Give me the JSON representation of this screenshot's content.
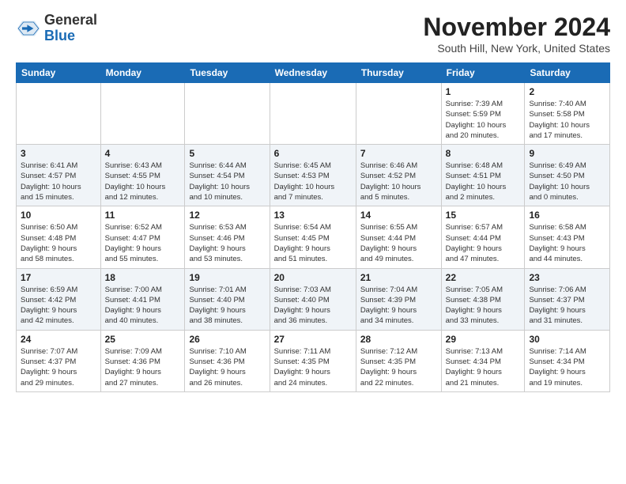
{
  "header": {
    "logo_general": "General",
    "logo_blue": "Blue",
    "month_title": "November 2024",
    "location": "South Hill, New York, United States"
  },
  "days_of_week": [
    "Sunday",
    "Monday",
    "Tuesday",
    "Wednesday",
    "Thursday",
    "Friday",
    "Saturday"
  ],
  "weeks": [
    [
      {
        "day": "",
        "info": ""
      },
      {
        "day": "",
        "info": ""
      },
      {
        "day": "",
        "info": ""
      },
      {
        "day": "",
        "info": ""
      },
      {
        "day": "",
        "info": ""
      },
      {
        "day": "1",
        "info": "Sunrise: 7:39 AM\nSunset: 5:59 PM\nDaylight: 10 hours\nand 20 minutes."
      },
      {
        "day": "2",
        "info": "Sunrise: 7:40 AM\nSunset: 5:58 PM\nDaylight: 10 hours\nand 17 minutes."
      }
    ],
    [
      {
        "day": "3",
        "info": "Sunrise: 6:41 AM\nSunset: 4:57 PM\nDaylight: 10 hours\nand 15 minutes."
      },
      {
        "day": "4",
        "info": "Sunrise: 6:43 AM\nSunset: 4:55 PM\nDaylight: 10 hours\nand 12 minutes."
      },
      {
        "day": "5",
        "info": "Sunrise: 6:44 AM\nSunset: 4:54 PM\nDaylight: 10 hours\nand 10 minutes."
      },
      {
        "day": "6",
        "info": "Sunrise: 6:45 AM\nSunset: 4:53 PM\nDaylight: 10 hours\nand 7 minutes."
      },
      {
        "day": "7",
        "info": "Sunrise: 6:46 AM\nSunset: 4:52 PM\nDaylight: 10 hours\nand 5 minutes."
      },
      {
        "day": "8",
        "info": "Sunrise: 6:48 AM\nSunset: 4:51 PM\nDaylight: 10 hours\nand 2 minutes."
      },
      {
        "day": "9",
        "info": "Sunrise: 6:49 AM\nSunset: 4:50 PM\nDaylight: 10 hours\nand 0 minutes."
      }
    ],
    [
      {
        "day": "10",
        "info": "Sunrise: 6:50 AM\nSunset: 4:48 PM\nDaylight: 9 hours\nand 58 minutes."
      },
      {
        "day": "11",
        "info": "Sunrise: 6:52 AM\nSunset: 4:47 PM\nDaylight: 9 hours\nand 55 minutes."
      },
      {
        "day": "12",
        "info": "Sunrise: 6:53 AM\nSunset: 4:46 PM\nDaylight: 9 hours\nand 53 minutes."
      },
      {
        "day": "13",
        "info": "Sunrise: 6:54 AM\nSunset: 4:45 PM\nDaylight: 9 hours\nand 51 minutes."
      },
      {
        "day": "14",
        "info": "Sunrise: 6:55 AM\nSunset: 4:44 PM\nDaylight: 9 hours\nand 49 minutes."
      },
      {
        "day": "15",
        "info": "Sunrise: 6:57 AM\nSunset: 4:44 PM\nDaylight: 9 hours\nand 47 minutes."
      },
      {
        "day": "16",
        "info": "Sunrise: 6:58 AM\nSunset: 4:43 PM\nDaylight: 9 hours\nand 44 minutes."
      }
    ],
    [
      {
        "day": "17",
        "info": "Sunrise: 6:59 AM\nSunset: 4:42 PM\nDaylight: 9 hours\nand 42 minutes."
      },
      {
        "day": "18",
        "info": "Sunrise: 7:00 AM\nSunset: 4:41 PM\nDaylight: 9 hours\nand 40 minutes."
      },
      {
        "day": "19",
        "info": "Sunrise: 7:01 AM\nSunset: 4:40 PM\nDaylight: 9 hours\nand 38 minutes."
      },
      {
        "day": "20",
        "info": "Sunrise: 7:03 AM\nSunset: 4:40 PM\nDaylight: 9 hours\nand 36 minutes."
      },
      {
        "day": "21",
        "info": "Sunrise: 7:04 AM\nSunset: 4:39 PM\nDaylight: 9 hours\nand 34 minutes."
      },
      {
        "day": "22",
        "info": "Sunrise: 7:05 AM\nSunset: 4:38 PM\nDaylight: 9 hours\nand 33 minutes."
      },
      {
        "day": "23",
        "info": "Sunrise: 7:06 AM\nSunset: 4:37 PM\nDaylight: 9 hours\nand 31 minutes."
      }
    ],
    [
      {
        "day": "24",
        "info": "Sunrise: 7:07 AM\nSunset: 4:37 PM\nDaylight: 9 hours\nand 29 minutes."
      },
      {
        "day": "25",
        "info": "Sunrise: 7:09 AM\nSunset: 4:36 PM\nDaylight: 9 hours\nand 27 minutes."
      },
      {
        "day": "26",
        "info": "Sunrise: 7:10 AM\nSunset: 4:36 PM\nDaylight: 9 hours\nand 26 minutes."
      },
      {
        "day": "27",
        "info": "Sunrise: 7:11 AM\nSunset: 4:35 PM\nDaylight: 9 hours\nand 24 minutes."
      },
      {
        "day": "28",
        "info": "Sunrise: 7:12 AM\nSunset: 4:35 PM\nDaylight: 9 hours\nand 22 minutes."
      },
      {
        "day": "29",
        "info": "Sunrise: 7:13 AM\nSunset: 4:34 PM\nDaylight: 9 hours\nand 21 minutes."
      },
      {
        "day": "30",
        "info": "Sunrise: 7:14 AM\nSunset: 4:34 PM\nDaylight: 9 hours\nand 19 minutes."
      }
    ]
  ]
}
